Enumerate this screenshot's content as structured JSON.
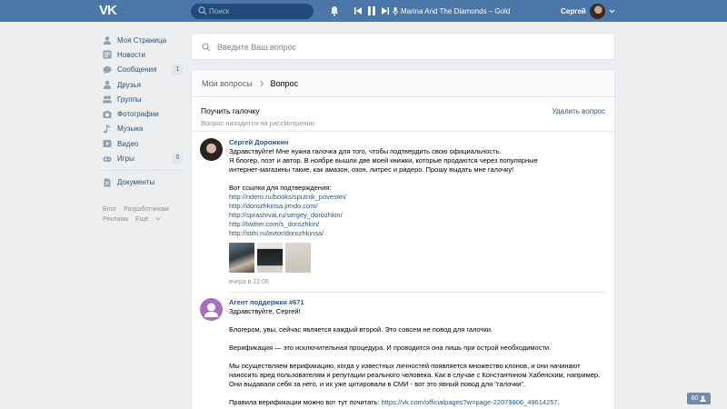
{
  "header": {
    "logo_text": "VK",
    "search_placeholder": "Поиск",
    "now_playing": "Marina And The Diamonds – Gold",
    "user_name": "Сергей"
  },
  "sidebar": {
    "items": [
      {
        "label": "Моя Страница",
        "icon": "home-icon"
      },
      {
        "label": "Новости",
        "icon": "news-icon"
      },
      {
        "label": "Сообщения",
        "icon": "messages-icon",
        "badge": "1"
      },
      {
        "label": "Друзья",
        "icon": "friends-icon"
      },
      {
        "label": "Группы",
        "icon": "groups-icon"
      },
      {
        "label": "Фотографии",
        "icon": "photos-icon"
      },
      {
        "label": "Музыка",
        "icon": "music-icon"
      },
      {
        "label": "Видео",
        "icon": "video-icon"
      },
      {
        "label": "Игры",
        "icon": "games-icon",
        "badge": "6"
      },
      {
        "label": "Документы",
        "icon": "documents-icon"
      }
    ],
    "footer": [
      "Блог",
      "Разработчикам",
      "Реклама",
      "Ещё"
    ]
  },
  "ask": {
    "placeholder": "Введите Ваш вопрос"
  },
  "breadcrumb": {
    "parent": "Мои вопросы",
    "current": "Вопрос"
  },
  "question": {
    "title": "Поучить галочку",
    "status": "Вопрос находится на рассмотрении.",
    "delete_label": "Удалить вопрос"
  },
  "messages": [
    {
      "author": "Сергей Дорожкин",
      "lines": [
        "Здравствуйте! Мне нужна галочка для того, чтобы подтвердить свою официальность.",
        "Я блогер, поэт и автор. В ноябре вышли две моей книжки, которые продаются через популярные",
        "интернет-магазины такие, как амазон, озон, литрес и ридеро. Прошу выдать мне галочку!"
      ],
      "links_intro": "Вот ссылки для подтверждения:",
      "links": [
        "http://ridero.ru/books/sputnik_povestei/",
        "http://dorozhkinsa.jimdo.com/",
        "http://sprashivai.ru/sergey_dorozhkin/",
        "http://twitter.com/s_dorozhkin/",
        "http://stihi.ru/avtor/dorozhkinsa/"
      ],
      "time": "вчера в 22:06"
    },
    {
      "author": "Агент поддержки #671",
      "greeting": "Здравствуйте, Сергей!",
      "p1": "Блогером, увы, сейчас является каждый второй. Это совсем не повод для галочки.",
      "p2": "Верификация — это исключительная процедура. И проводится она лишь при острой необходимости.",
      "p3_lines": [
        "Мы осуществляем верификацию, когда у известных личностей появляется множество клонов, и они начинают",
        "наносить вред пользователям и репутации реального человека. Как в случае с Константином Хабенским, например.",
        "Они выдавали себя за него, и их уже цитировали в СМИ - вот это явный повод для \"галочки\"."
      ],
      "rules_text": "Правила верификации можно вот тут почитать: ",
      "rules_link": "https://vk.com/officialpages?w=page-22079806_49614257",
      "rules_end": "."
    }
  ],
  "counter": "60",
  "colors": {
    "header": "#4a76a8",
    "link": "#2a5885",
    "background": "#edeef0"
  }
}
